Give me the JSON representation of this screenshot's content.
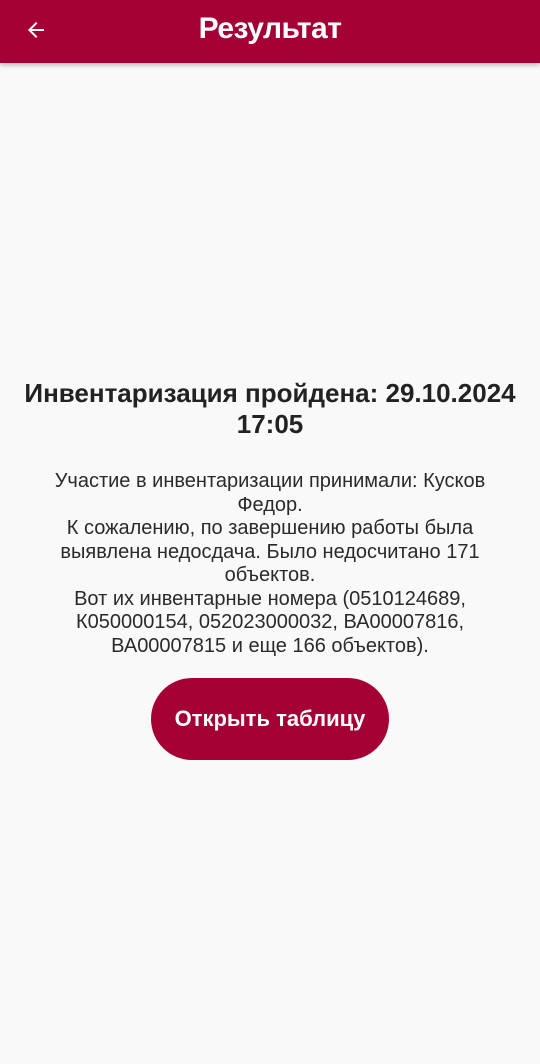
{
  "app_bar": {
    "title": "Результат",
    "back_icon": "arrow-left-icon",
    "color": "#a50034"
  },
  "result": {
    "headline": "Инвентаризация пройдена: 29.10.2024 17:05",
    "participants_line": "Участие в инвентаризации принимали: Кусков Федор.",
    "shortage_line": "К сожалению, по завершению работы была выявлена недосдача. Было недосчитано 171 объектов.",
    "inventory_numbers_line": "Вот их инвентарные номера (0510124689, К050000154, 052023000032, ВА00007816, ВА00007815 и еще 166 объектов)."
  },
  "actions": {
    "open_table_label": "Открыть таблицу",
    "button_color": "#a50034"
  }
}
